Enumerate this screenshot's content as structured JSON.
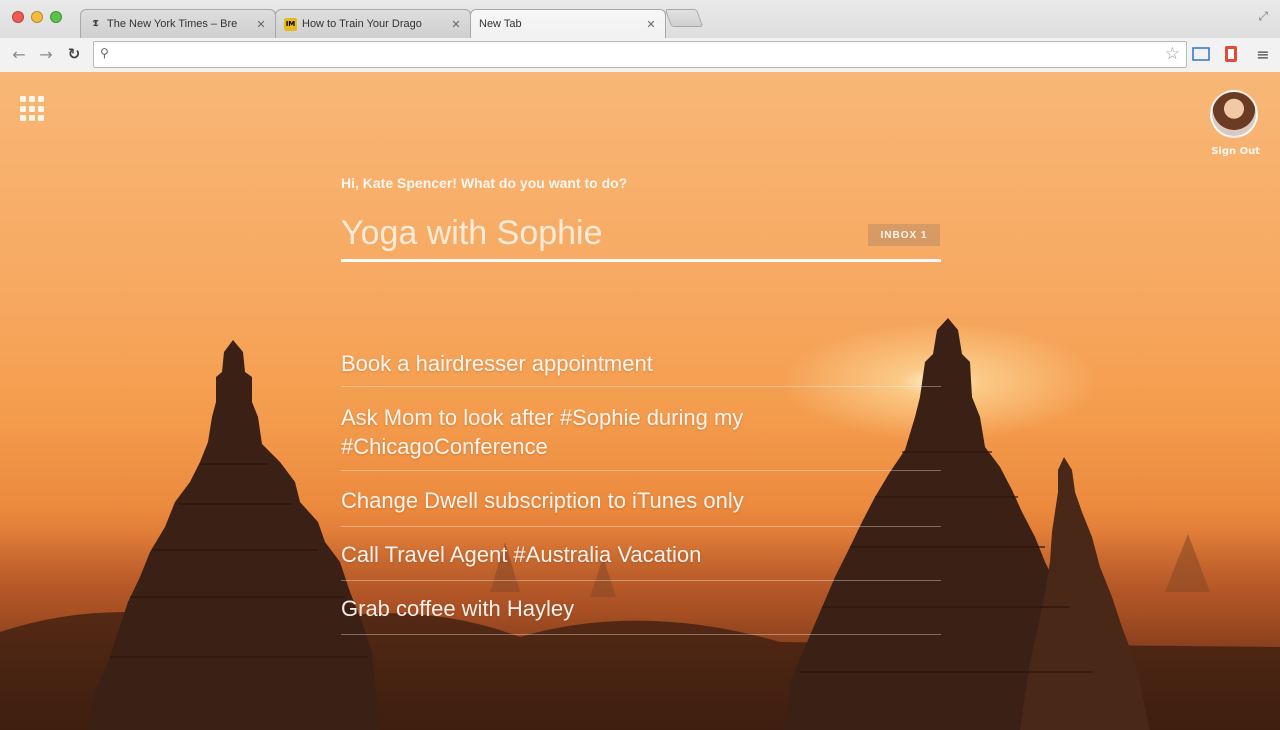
{
  "browser": {
    "tabs": [
      {
        "title": "The New York Times – Bre",
        "favicon": "nyt-icon",
        "active": false
      },
      {
        "title": "How to Train Your Drago",
        "favicon": "imdb-icon",
        "active": false
      },
      {
        "title": "New Tab",
        "favicon": "",
        "active": true
      }
    ],
    "address": ""
  },
  "page": {
    "greeting": "Hi, Kate Spencer! What do you want to do?",
    "input_value": "Yoga with Sophie",
    "inbox_badge": "INBOX 1",
    "user": {
      "signout_label": "Sign Out"
    },
    "tasks": [
      "Book a hairdresser appointment",
      "Ask Mom to look after #Sophie during my #ChicagoConference",
      "Change Dwell subscription to iTunes only",
      "Call Travel Agent #Australia Vacation",
      "Grab coffee with Hayley"
    ]
  }
}
